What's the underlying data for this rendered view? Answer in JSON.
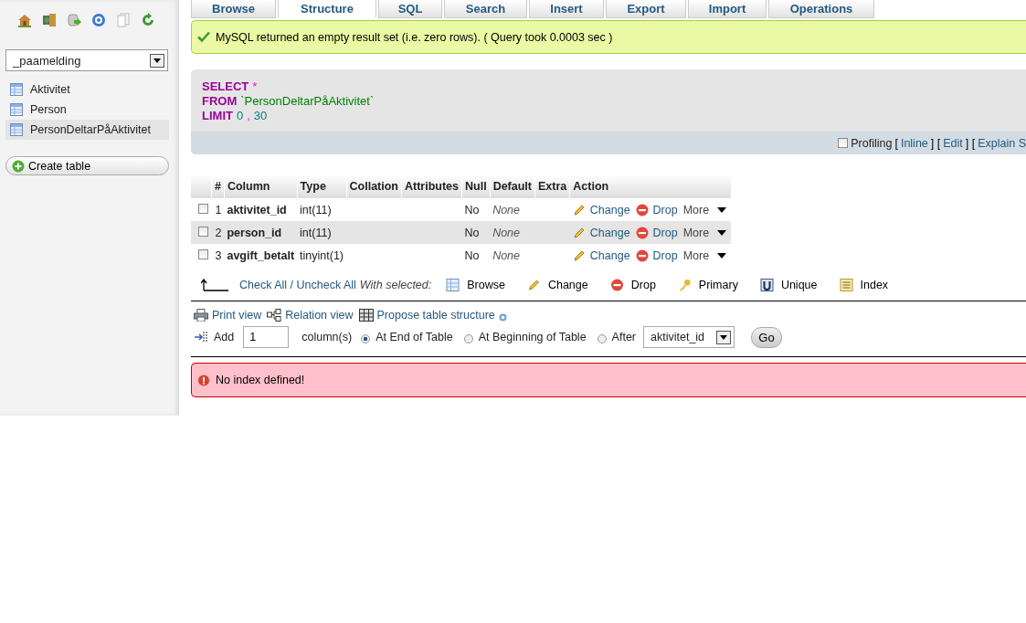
{
  "sidebar": {
    "toolbar": [
      {
        "kind": "home"
      },
      {
        "kind": "exit"
      },
      {
        "kind": "query"
      },
      {
        "kind": "help"
      },
      {
        "kind": "docs"
      },
      {
        "kind": "reload"
      }
    ],
    "database": "_paamelding",
    "tables": [
      {
        "name": "Aktivitet",
        "selected": false
      },
      {
        "name": "Person",
        "selected": false
      },
      {
        "name": "PersonDeltarPåAktivitet",
        "selected": true
      }
    ],
    "create_table": "Create table"
  },
  "tabs": [
    {
      "label": "Browse",
      "selected": false
    },
    {
      "label": "Structure",
      "selected": true
    },
    {
      "label": "SQL",
      "selected": false
    },
    {
      "label": "Search",
      "selected": false
    },
    {
      "label": "Insert",
      "selected": false
    },
    {
      "label": "Export",
      "selected": false
    },
    {
      "label": "Import",
      "selected": false
    },
    {
      "label": "Operations",
      "selected": false
    }
  ],
  "success_message": "MySQL returned an empty result set (i.e. zero rows). ( Query took 0.0003 sec )",
  "sql": {
    "lines": [
      [
        {
          "kind": "keyword",
          "text": "SELECT"
        },
        {
          "kind": "punct",
          "text": "*"
        }
      ],
      [
        {
          "kind": "keyword",
          "text": "FROM"
        },
        {
          "kind": "identifier",
          "text": "`PersonDeltarPåAktivitet`"
        }
      ],
      [
        {
          "kind": "keyword",
          "text": "LIMIT"
        },
        {
          "kind": "number",
          "text": "0"
        },
        {
          "kind": "punct",
          "text": ","
        },
        {
          "kind": "number",
          "text": "30"
        }
      ]
    ],
    "profiling": {
      "label": "Profiling",
      "checked": false
    },
    "links": [
      {
        "kind": "text",
        "text": "["
      },
      {
        "kind": "link",
        "text": "Inline"
      },
      {
        "kind": "text",
        "text": "] ["
      },
      {
        "kind": "link",
        "text": "Edit"
      },
      {
        "kind": "text",
        "text": "] ["
      },
      {
        "kind": "link",
        "text": "Explain S"
      }
    ]
  },
  "table": {
    "columns": [
      "#",
      "Column",
      "Type",
      "Collation",
      "Attributes",
      "Null",
      "Default",
      "Extra",
      "Action"
    ],
    "rows": [
      {
        "checked": false,
        "num": "1",
        "name": "aktivitet_id",
        "type": "int(11)",
        "null": "No",
        "default": "None",
        "actions": [
          "Change",
          "Drop",
          "More"
        ]
      },
      {
        "checked": false,
        "num": "2",
        "name": "person_id",
        "type": "int(11)",
        "null": "No",
        "default": "None",
        "actions": [
          "Change",
          "Drop",
          "More"
        ]
      },
      {
        "checked": false,
        "num": "3",
        "name": "avgift_betalt",
        "type": "tinyint(1)",
        "null": "No",
        "default": "None",
        "actions": [
          "Change",
          "Drop",
          "More"
        ]
      }
    ]
  },
  "bulk": {
    "check_all": "Check All / Uncheck All",
    "with_selected": "With selected:",
    "buttons": [
      {
        "kind": "browse",
        "label": "Browse"
      },
      {
        "kind": "change",
        "label": "Change"
      },
      {
        "kind": "drop",
        "label": "Drop"
      },
      {
        "kind": "primary",
        "label": "Primary"
      },
      {
        "kind": "unique",
        "label": "Unique"
      },
      {
        "kind": "index",
        "label": "Index"
      }
    ]
  },
  "links": [
    {
      "kind": "print",
      "label": "Print view"
    },
    {
      "kind": "relation",
      "label": "Relation view"
    },
    {
      "kind": "propose",
      "label": "Propose table structure"
    }
  ],
  "add_columns": {
    "label": "Add",
    "count": "1",
    "unit": "column(s)",
    "positions": [
      {
        "label": "At End of Table",
        "selected": true
      },
      {
        "label": "At Beginning of Table",
        "selected": false
      },
      {
        "label": "After",
        "selected": false
      }
    ],
    "after_column": "aktivitet_id",
    "go": "Go"
  },
  "error_message": "No index defined!"
}
